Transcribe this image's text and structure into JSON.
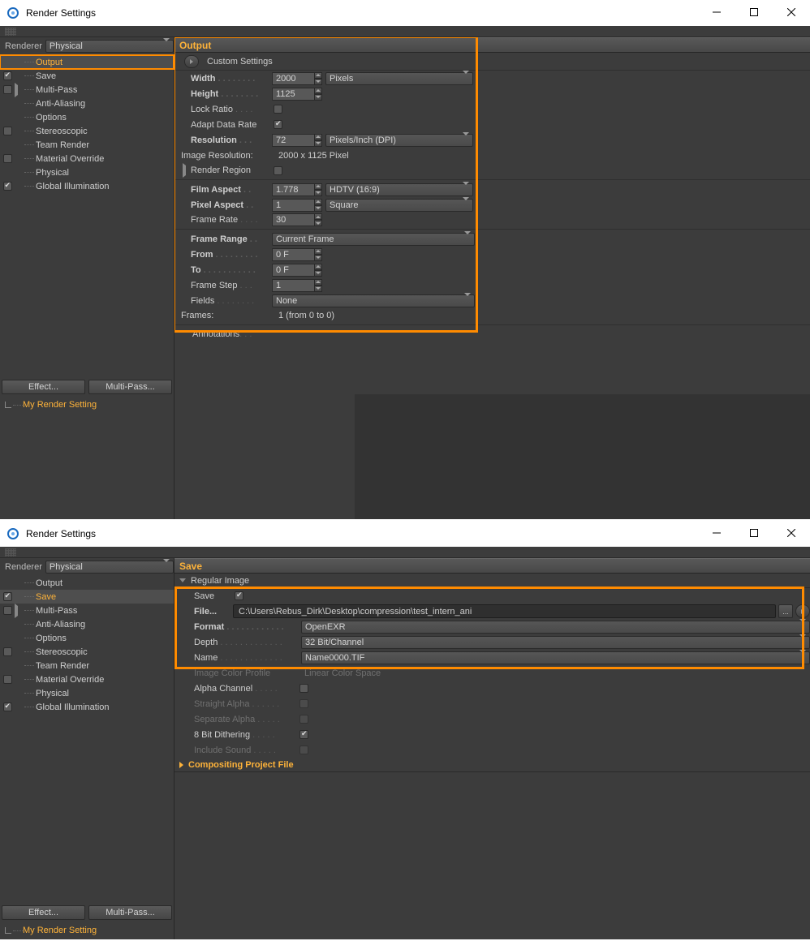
{
  "colors": {
    "accent": "#feb33a",
    "highlight": "#ff8b00"
  },
  "window": {
    "title": "Render Settings"
  },
  "sidebar": {
    "renderer_label": "Renderer",
    "renderer_value": "Physical",
    "items": [
      {
        "label": "Output"
      },
      {
        "label": "Save"
      },
      {
        "label": "Multi-Pass"
      },
      {
        "label": "Anti-Aliasing"
      },
      {
        "label": "Options"
      },
      {
        "label": "Stereoscopic"
      },
      {
        "label": "Team Render"
      },
      {
        "label": "Material Override"
      },
      {
        "label": "Physical"
      },
      {
        "label": "Global Illumination"
      }
    ],
    "effect_btn": "Effect...",
    "multipass_btn": "Multi-Pass...",
    "render_setting": "My Render Setting"
  },
  "output_panel": {
    "header": "Output",
    "custom_settings": "Custom Settings",
    "width": {
      "label": "Width",
      "value": "2000",
      "unit": "Pixels"
    },
    "height": {
      "label": "Height",
      "value": "1125"
    },
    "lock_ratio": "Lock Ratio",
    "adapt_data": "Adapt Data Rate",
    "resolution": {
      "label": "Resolution",
      "value": "72",
      "unit": "Pixels/Inch (DPI)"
    },
    "image_res": {
      "label": "Image Resolution:",
      "value": "2000 x 1125 Pixel"
    },
    "render_region": "Render Region",
    "film_aspect": {
      "label": "Film Aspect",
      "value": "1.778",
      "preset": "HDTV (16:9)"
    },
    "pixel_aspect": {
      "label": "Pixel Aspect",
      "value": "1",
      "preset": "Square"
    },
    "frame_rate": {
      "label": "Frame Rate",
      "value": "30"
    },
    "frame_range": {
      "label": "Frame Range",
      "value": "Current Frame"
    },
    "from": {
      "label": "From",
      "value": "0 F"
    },
    "to": {
      "label": "To",
      "value": "0 F"
    },
    "frame_step": {
      "label": "Frame Step",
      "value": "1"
    },
    "fields": {
      "label": "Fields",
      "value": "None"
    },
    "frames": {
      "label": "Frames:",
      "value": "1 (from 0 to 0)"
    },
    "annotations": "Annotations"
  },
  "save_panel": {
    "header": "Save",
    "regular_image": "Regular Image",
    "save_label": "Save",
    "file_label": "File...",
    "file_path": "C:\\Users\\Rebus_Dirk\\Desktop\\compression\\test_intern_ani",
    "browse": "...",
    "format": {
      "label": "Format",
      "value": "OpenEXR"
    },
    "depth": {
      "label": "Depth",
      "value": "32 Bit/Channel"
    },
    "name": {
      "label": "Name",
      "value": "Name0000.TIF"
    },
    "color_profile": {
      "label": "Image Color Profile",
      "value": "Linear Color Space"
    },
    "alpha_channel": "Alpha Channel",
    "straight_alpha": "Straight Alpha",
    "separate_alpha": "Separate Alpha",
    "dithering": "8 Bit Dithering",
    "include_sound": "Include Sound",
    "compositing": "Compositing Project File"
  }
}
